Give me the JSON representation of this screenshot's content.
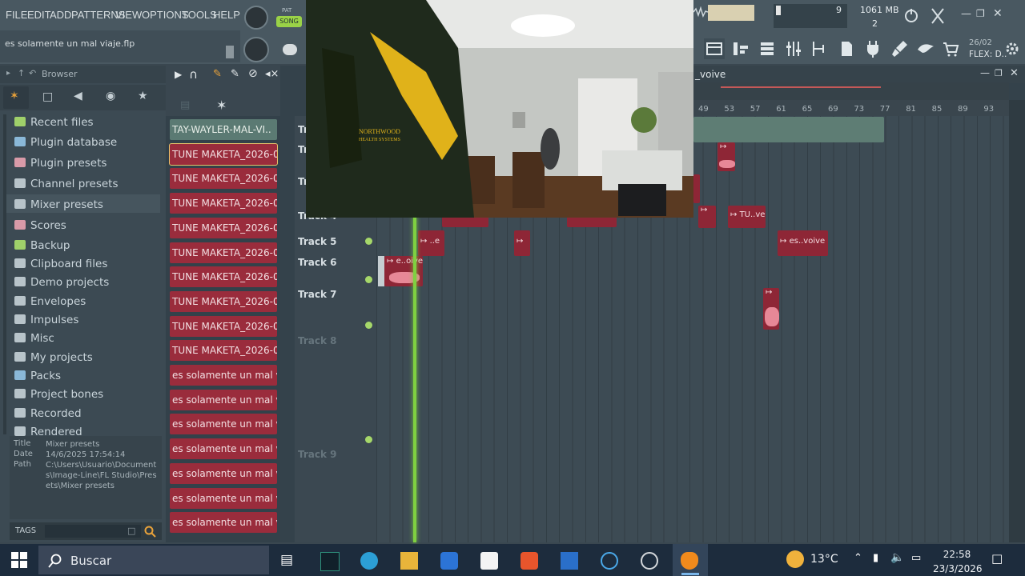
{
  "menu": {
    "items": [
      "FILE",
      "EDIT",
      "ADD",
      "PATTERNS",
      "VIEW",
      "OPTIONS",
      "TOOLS",
      "HELP"
    ],
    "song_mode": "SONG",
    "pat_label": "PAT",
    "hint": "es solamente un mal viaje.flp"
  },
  "monitor": {
    "value1": "9",
    "memory": "1061 MB",
    "value2": "2"
  },
  "toolbar_right": {
    "date": "26/02",
    "flex": "FLEX: D.."
  },
  "browser": {
    "title": "Browser",
    "items": [
      {
        "label": "Recent files",
        "icon": "folder-icon",
        "color": "#9fd06a"
      },
      {
        "label": "Plugin database",
        "icon": "plug-icon",
        "color": "#8ab8d8"
      },
      {
        "label": "Plugin presets",
        "icon": "plug-icon",
        "color": "#d89aa8"
      },
      {
        "label": "Channel presets",
        "icon": "channel-icon",
        "color": "#b8c4ca"
      },
      {
        "label": "Mixer presets",
        "icon": "mixer-icon",
        "color": "#b8c4ca"
      },
      {
        "label": "Scores",
        "icon": "note-icon",
        "color": "#d89aa8"
      },
      {
        "label": "Backup",
        "icon": "folder-icon",
        "color": "#9fd06a"
      },
      {
        "label": "Clipboard files",
        "icon": "folder-icon",
        "color": "#b8c4ca"
      },
      {
        "label": "Demo projects",
        "icon": "folder-icon",
        "color": "#b8c4ca"
      },
      {
        "label": "Envelopes",
        "icon": "folder-icon",
        "color": "#b8c4ca"
      },
      {
        "label": "Impulses",
        "icon": "folder-icon",
        "color": "#b8c4ca"
      },
      {
        "label": "Misc",
        "icon": "folder-icon",
        "color": "#b8c4ca"
      },
      {
        "label": "My projects",
        "icon": "folder-icon",
        "color": "#b8c4ca"
      },
      {
        "label": "Packs",
        "icon": "folder-icon",
        "color": "#8ab8d8"
      },
      {
        "label": "Project bones",
        "icon": "folder-icon",
        "color": "#b8c4ca"
      },
      {
        "label": "Recorded",
        "icon": "folder-icon",
        "color": "#b8c4ca"
      },
      {
        "label": "Rendered",
        "icon": "folder-icon",
        "color": "#b8c4ca"
      }
    ],
    "info": {
      "title_key": "Title",
      "title_val": "Mixer presets",
      "date_key": "Date",
      "date_val": "14/6/2025 17:54:14",
      "path_key": "Path",
      "path_val": "C:\\Users\\Usuario\\Documents\\Image-Line\\FL Studio\\Presets\\Mixer presets"
    },
    "tags_label": "TAGS"
  },
  "clips": [
    "TAY-WAYLER-MAL-VI..",
    "TUNE MAKETA_2026-03-..",
    "TUNE MAKETA_2026-03-..",
    "TUNE MAKETA_2026-03-..",
    "TUNE MAKETA_2026-03-..",
    "TUNE MAKETA_2026-03-..",
    "TUNE MAKETA_2026-03-..",
    "TUNE MAKETA_2026-03-..",
    "TUNE MAKETA_2026-03-..",
    "TUNE MAKETA_2026-03-..",
    "es solamente un mal viaj..",
    "es solamente un mal viaj..",
    "es solamente un mal viaj..",
    "es solamente un mal viaj..",
    "es solamente un mal viaj..",
    "es solamente un mal viaj..",
    "es solamente un mal viaj.."
  ],
  "playlist": {
    "title": "_voive",
    "ruler": [
      "49",
      "53",
      "57",
      "61",
      "65",
      "69",
      "73",
      "77",
      "81",
      "85",
      "89",
      "93"
    ],
    "tracks": [
      "Track 5",
      "Track 6",
      "Track 7",
      "Track 8",
      "Track 9"
    ],
    "track_partial": [
      "Tr",
      "Tr",
      "Tr",
      "Track 4"
    ],
    "clip_labels": {
      "t4a": "TU..ve",
      "t5a": "..e",
      "t5b": "es..voive",
      "t6a": "e..oive"
    }
  },
  "webcam": {
    "jacket_text": "NORTHWOOD HEALTH SYSTEMS"
  },
  "taskbar": {
    "search": "Buscar",
    "temperature": "13°C",
    "time": "22:58",
    "date": "23/3/2026"
  }
}
